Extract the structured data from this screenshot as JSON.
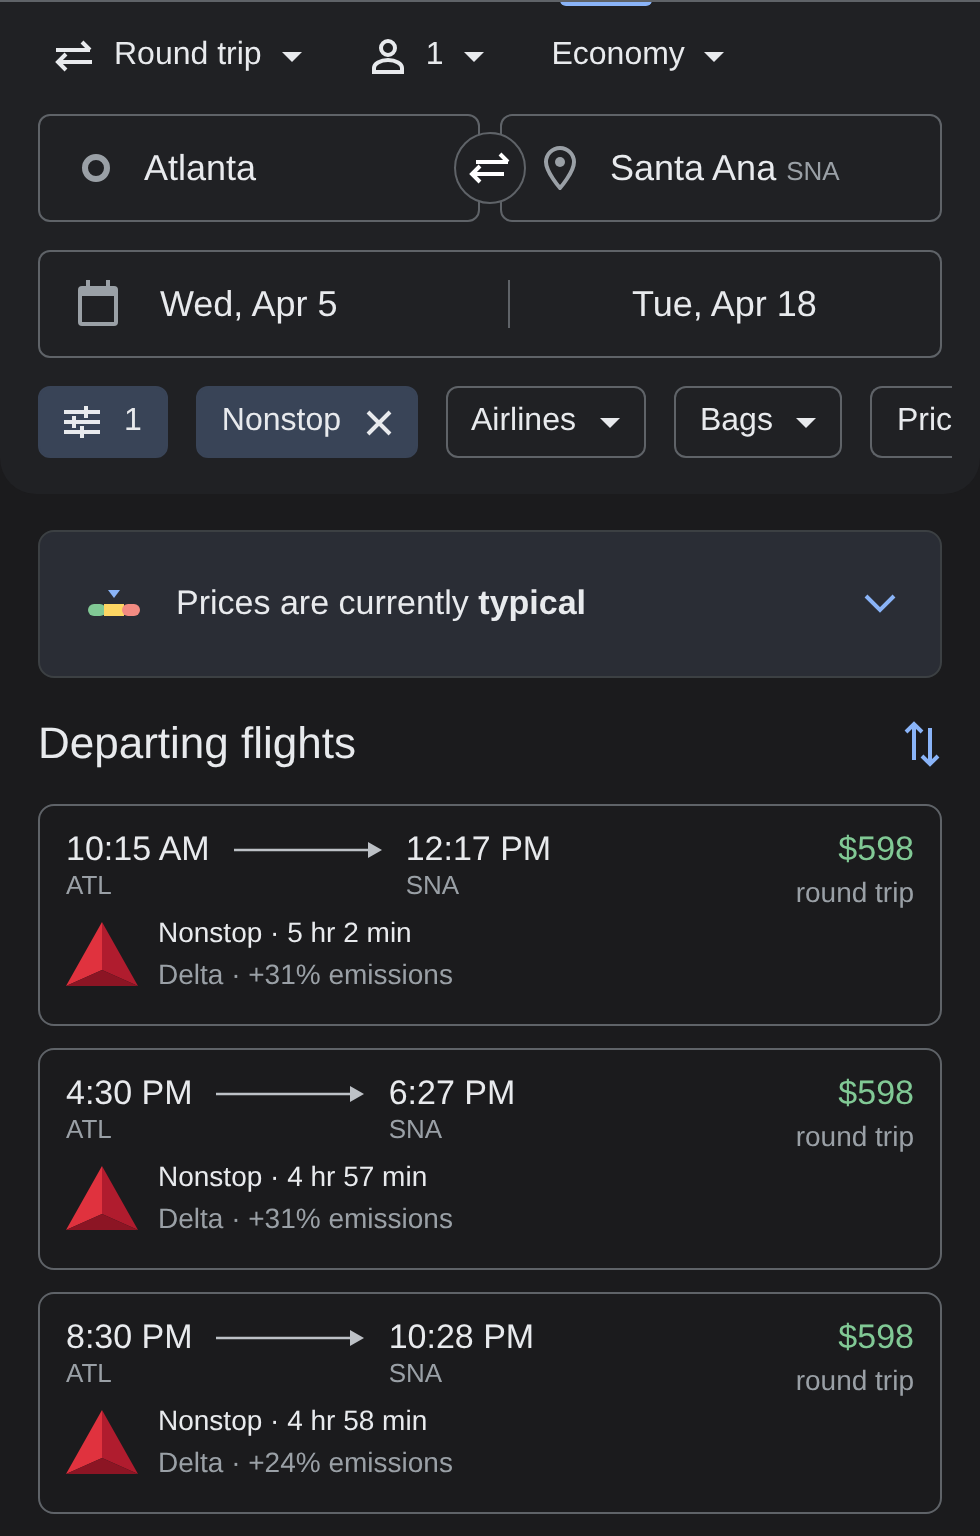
{
  "trip_options": [
    {
      "kind": "trip",
      "label": "Round trip"
    },
    {
      "kind": "passengers",
      "label": "1"
    },
    {
      "kind": "cabin",
      "label": "Economy"
    }
  ],
  "origin": {
    "value": "Atlanta"
  },
  "destination": {
    "value": "Santa Ana",
    "code": "SNA"
  },
  "dates": {
    "depart": "Wed, Apr 5",
    "return": "Tue, Apr 18"
  },
  "filters": [
    {
      "kind": "all_filters",
      "label": "1",
      "selected": true
    },
    {
      "kind": "chip",
      "label": "Nonstop",
      "selected": true
    },
    {
      "kind": "chip",
      "label": "Airlines",
      "selected": false
    },
    {
      "kind": "chip",
      "label": "Bags",
      "selected": false
    },
    {
      "kind": "chip",
      "label": "Pric",
      "selected": false
    }
  ],
  "price_insight": {
    "text": "Prices are currently **typical**",
    "expanded": false
  },
  "section_title": "Departing flights",
  "flights": [
    {
      "depart_time": "10:15 AM",
      "depart_airport": "ATL",
      "arrive_time": "12:17 PM",
      "arrive_airport": "SNA",
      "price": "$598",
      "price_note": "round trip",
      "stops_duration": "Nonstop · 5 hr 2 min",
      "airline_emissions": "Delta · +31% emissions"
    },
    {
      "depart_time": "4:30 PM",
      "depart_airport": "ATL",
      "arrive_time": "6:27 PM",
      "arrive_airport": "SNA",
      "price": "$598",
      "price_note": "round trip",
      "stops_duration": "Nonstop · 4 hr 57 min",
      "airline_emissions": "Delta · +31% emissions"
    },
    {
      "depart_time": "8:30 PM",
      "depart_airport": "ATL",
      "arrive_time": "10:28 PM",
      "arrive_airport": "SNA",
      "price": "$598",
      "price_note": "round trip",
      "stops_duration": "Nonstop · 4 hr 58 min",
      "airline_emissions": "Delta · +24% emissions"
    }
  ]
}
